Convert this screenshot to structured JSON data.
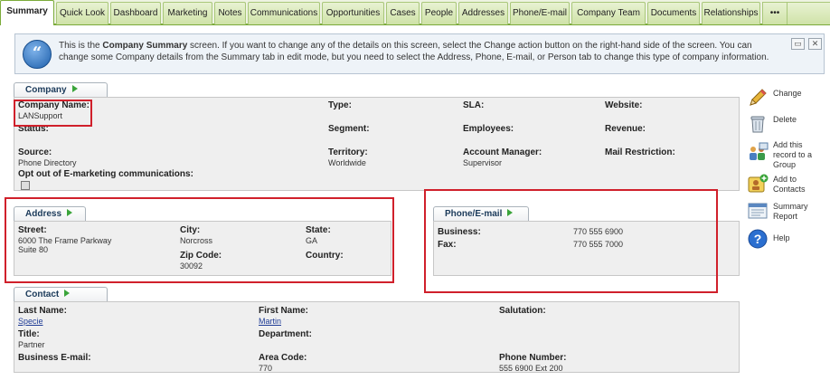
{
  "tabs": [
    "Summary",
    "Quick Look",
    "Dashboard",
    "Marketing",
    "Notes",
    "Communications",
    "Opportunities",
    "Cases",
    "People",
    "Addresses",
    "Phone/E-mail",
    "Company Team",
    "Documents",
    "Relationships"
  ],
  "tab_more": "•••",
  "info": {
    "t1": "This is the ",
    "t2": "Company Summary",
    "t3": " screen. If you want to change any of the details on this screen, select the Change action button on the right-hand side of the screen. You can change some Company details from the Summary tab in edit mode, but you need to select the Address, Phone, E-mail, or Person tab to change this type of company information."
  },
  "company": {
    "caption": "Company",
    "name_label": "Company Name:",
    "name_value": "LANSupport",
    "status_label": "Status:",
    "source_label": "Source:",
    "source_value": "Phone Directory",
    "optout_label": "Opt out of E-marketing communications:",
    "type_label": "Type:",
    "segment_label": "Segment:",
    "territory_label": "Territory:",
    "territory_value": "Worldwide",
    "sla_label": "SLA:",
    "employees_label": "Employees:",
    "account_manager_label": "Account Manager:",
    "account_manager_value": "Supervisor",
    "website_label": "Website:",
    "revenue_label": "Revenue:",
    "mail_restriction_label": "Mail Restriction:"
  },
  "address": {
    "caption": "Address",
    "street_label": "Street:",
    "street_line1": "6000 The Frame Parkway",
    "street_line2": "Suite 80",
    "city_label": "City:",
    "city_value": "Norcross",
    "zip_label": "Zip Code:",
    "zip_value": "30092",
    "state_label": "State:",
    "state_value": "GA",
    "country_label": "Country:"
  },
  "phone": {
    "caption": "Phone/E-mail",
    "business_label": "Business:",
    "business_value": "770 555 6900",
    "fax_label": "Fax:",
    "fax_value": "770 555 7000"
  },
  "contact": {
    "caption": "Contact",
    "last_name_label": "Last Name:",
    "last_name_value": "Specie",
    "title_label": "Title:",
    "title_value": "Partner",
    "business_email_label": "Business E-mail:",
    "first_name_label": "First Name:",
    "first_name_value": "Martin",
    "department_label": "Department:",
    "area_code_label": "Area Code:",
    "area_code_value": "770",
    "salutation_label": "Salutation:",
    "phone_number_label": "Phone Number:",
    "phone_number_value": "555 6900 Ext 200"
  },
  "actions": {
    "change": "Change",
    "delete": "Delete",
    "add_group": "Add this record to a Group",
    "add_contacts": "Add to Contacts",
    "summary_report": "Summary Report",
    "help": "Help"
  },
  "colors": {
    "tab_accent": "#7bab3a",
    "highlight": "#d0202b",
    "link": "#1f3c96"
  }
}
